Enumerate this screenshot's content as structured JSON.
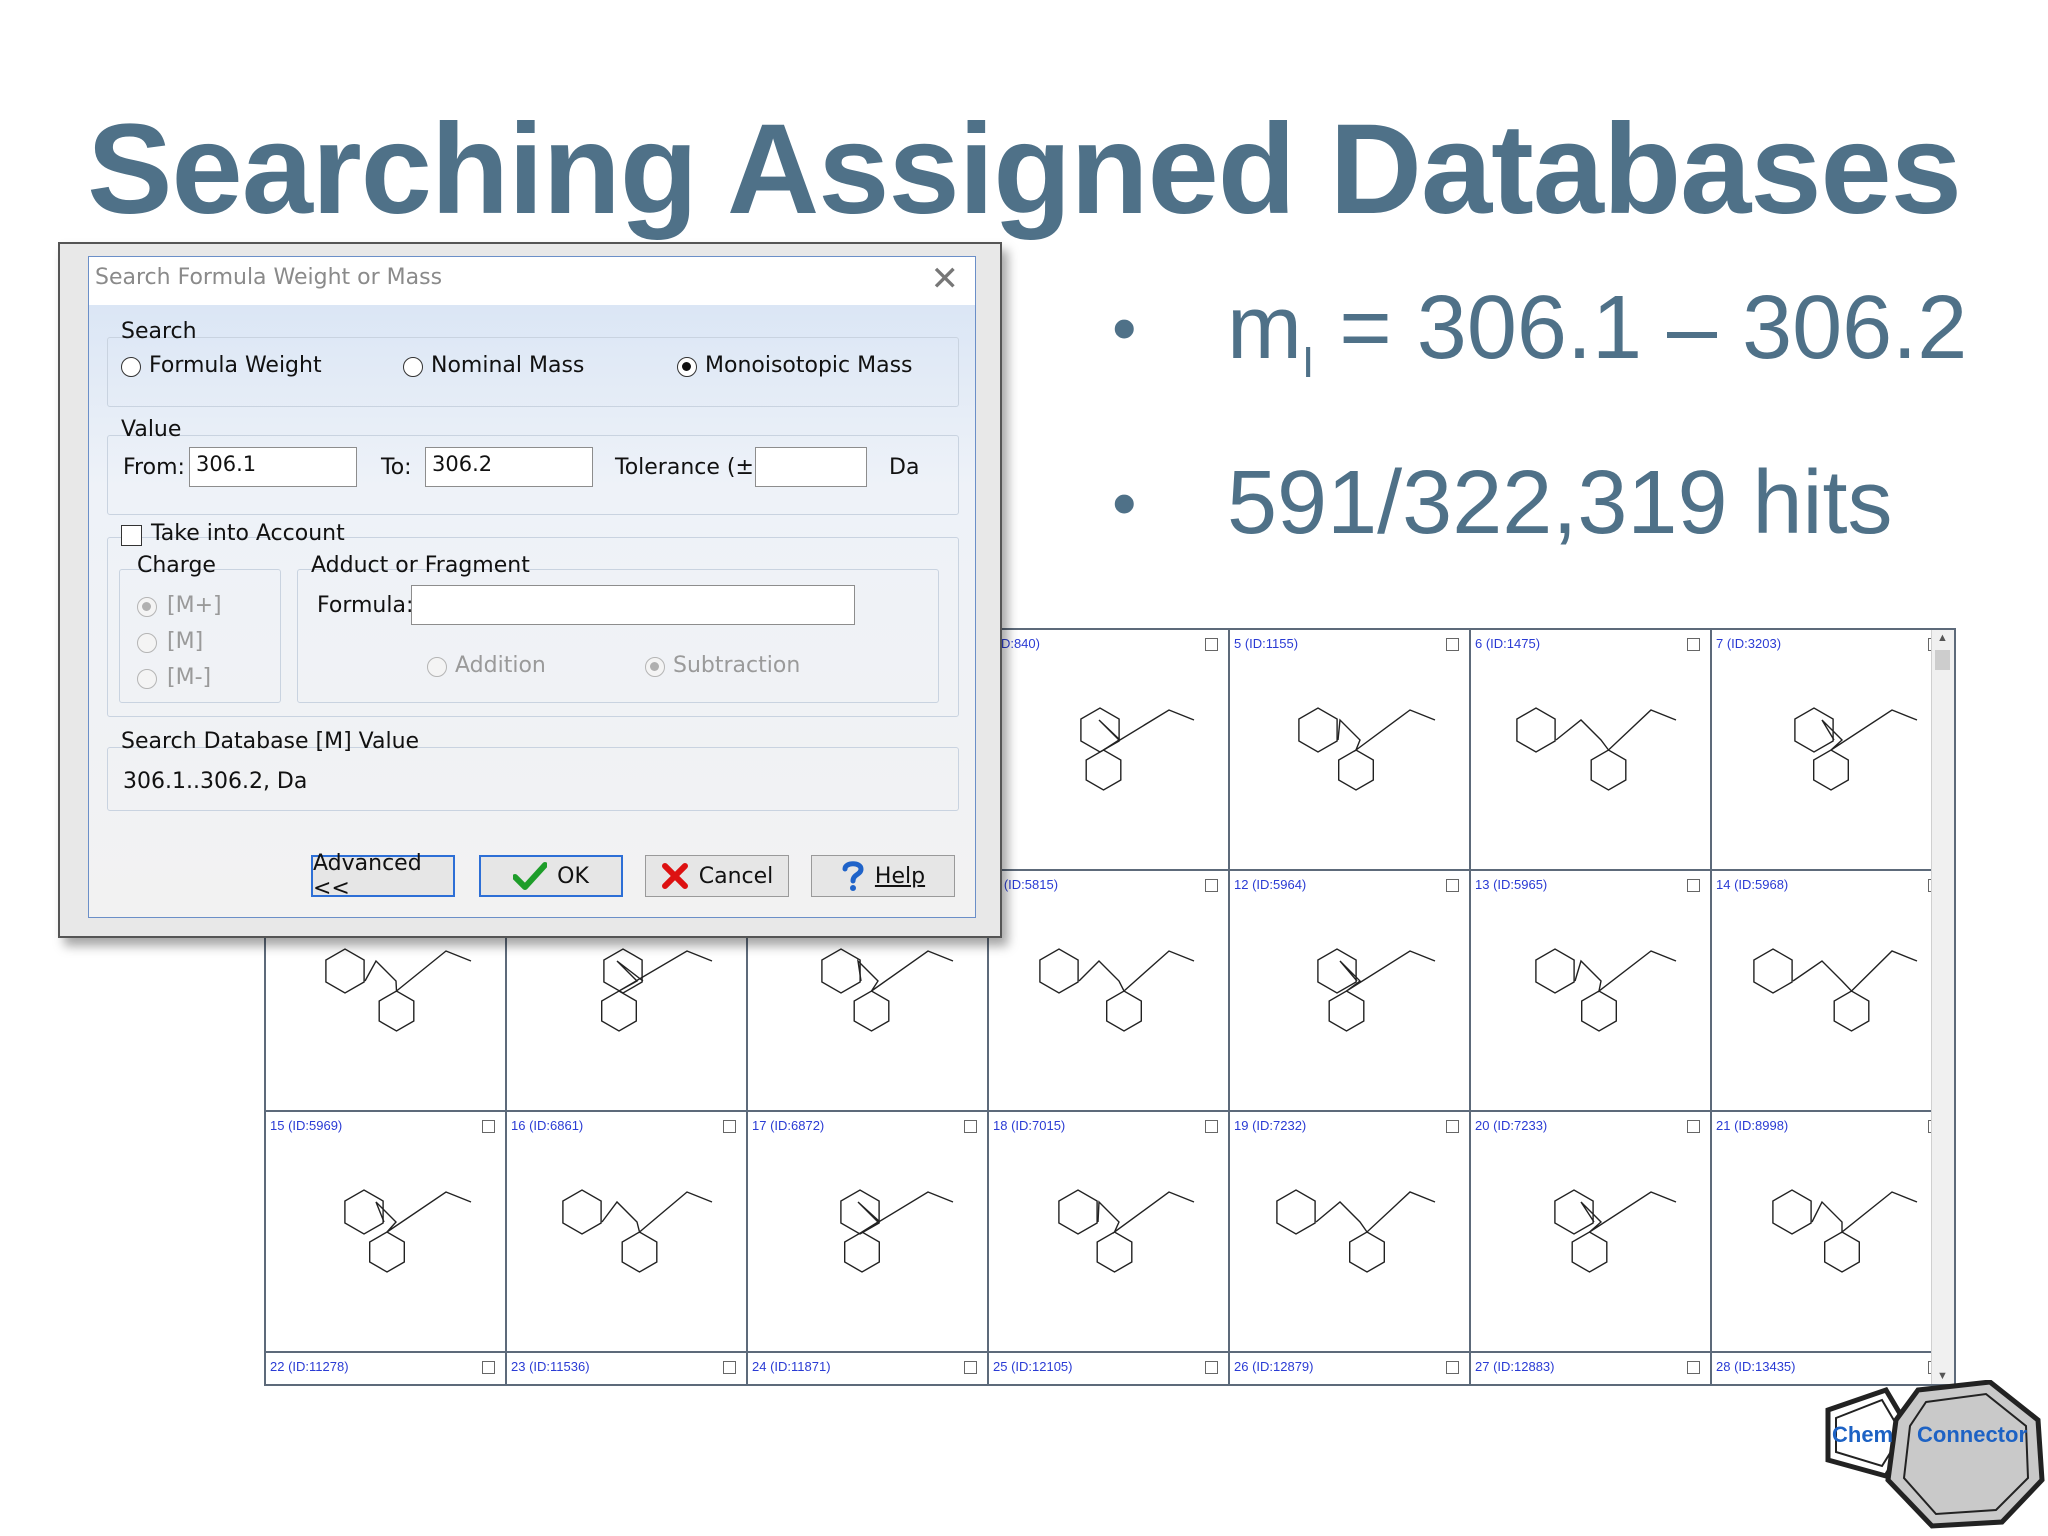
{
  "slide": {
    "title": "Searching Assigned Databases",
    "bullets": [
      {
        "dot": "•",
        "main": "m",
        "sub": "I",
        "rest": " = 306.1 – 306.2"
      },
      {
        "dot": "•",
        "main": "591/322,319 hits",
        "sub": "",
        "rest": ""
      }
    ]
  },
  "dialog": {
    "title": "Search Formula Weight or Mass",
    "close": "✕",
    "search_group": {
      "label": "Search",
      "options": [
        "Formula Weight",
        "Nominal Mass",
        "Monoisotopic Mass"
      ],
      "selected": "Monoisotopic Mass"
    },
    "value_group": {
      "label": "Value",
      "from_label": "From:",
      "from_value": "306.1",
      "to_label": "To:",
      "to_value": "306.2",
      "tolerance_label": "Tolerance (±):",
      "tolerance_value": "",
      "unit": "Da"
    },
    "take_into_account": {
      "label": "Take into Account",
      "checked": false,
      "charge": {
        "label": "Charge",
        "options": [
          "[M+]",
          "[M]",
          "[M-]"
        ],
        "selected": "[M+]"
      },
      "adduct": {
        "label": "Adduct or Fragment",
        "formula_label": "Formula:",
        "formula_value": "",
        "options": [
          "Addition",
          "Subtraction"
        ],
        "selected": "Subtraction"
      }
    },
    "db_value": {
      "label": "Search Database [M] Value",
      "value": "306.1..306.2, Da"
    },
    "buttons": {
      "advanced": "Advanced <<",
      "ok": "OK",
      "cancel": "Cancel",
      "help": "Help"
    }
  },
  "results": {
    "cells": [
      "",
      "",
      "",
      "(ID:840)",
      "5 (ID:1155)",
      "6 (ID:1475)",
      "7 (ID:3203)",
      "",
      "",
      "",
      "1 (ID:5815)",
      "12 (ID:5964)",
      "13 (ID:5965)",
      "14 (ID:5968)",
      "15 (ID:5969)",
      "16 (ID:6861)",
      "17 (ID:6872)",
      "18 (ID:7015)",
      "19 (ID:7232)",
      "20 (ID:7233)",
      "21 (ID:8998)",
      "22 (ID:11278)",
      "23 (ID:11536)",
      "24 (ID:11871)",
      "25 (ID:12105)",
      "26 (ID:12879)",
      "27 (ID:12883)",
      "28 (ID:13435)"
    ]
  },
  "logo": {
    "left": "Chem",
    "right": "Connector"
  }
}
